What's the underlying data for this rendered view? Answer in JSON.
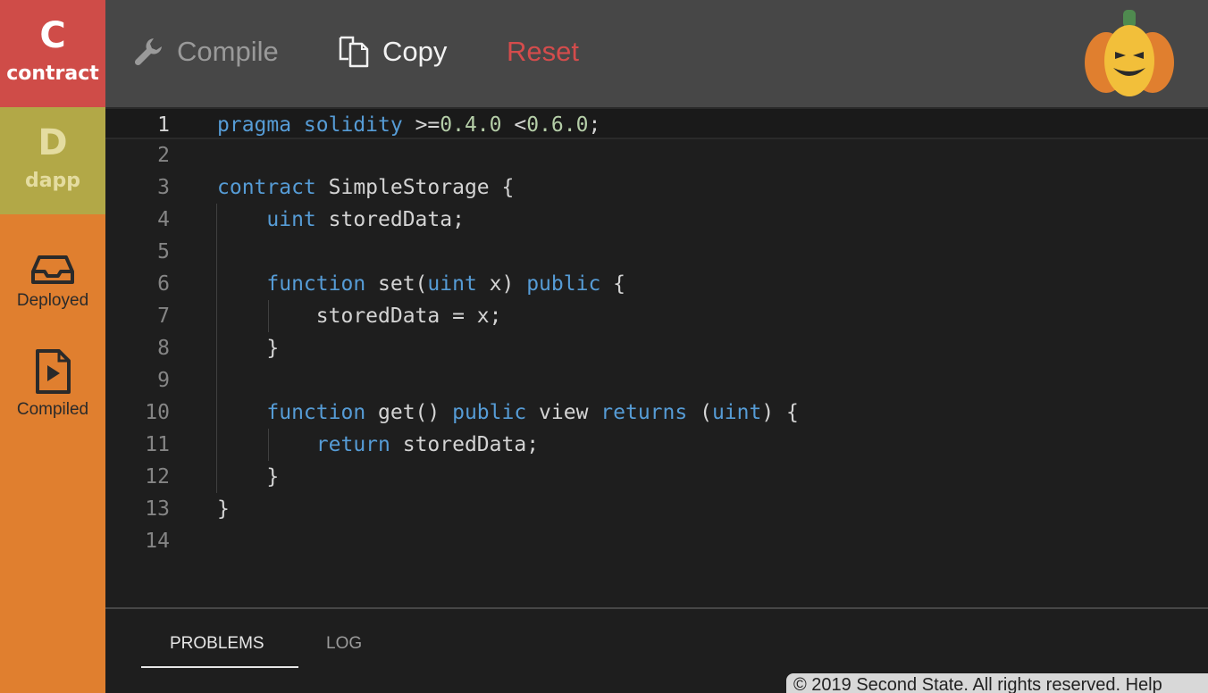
{
  "sidebar": {
    "contract": {
      "letter": "C",
      "label": "contract"
    },
    "dapp": {
      "letter": "D",
      "label": "dapp"
    },
    "deployed": {
      "label": "Deployed",
      "icon": "inbox-icon"
    },
    "compiled": {
      "label": "Compiled",
      "icon": "play-file-icon"
    }
  },
  "toolbar": {
    "compile_label": "Compile",
    "copy_label": "Copy",
    "reset_label": "Reset"
  },
  "editor": {
    "active_line": 1,
    "lines": [
      {
        "n": "1",
        "text": "pragma solidity >=0.4.0 <0.6.0;"
      },
      {
        "n": "2",
        "text": ""
      },
      {
        "n": "3",
        "text": "contract SimpleStorage {"
      },
      {
        "n": "4",
        "text": "    uint storedData;"
      },
      {
        "n": "5",
        "text": ""
      },
      {
        "n": "6",
        "text": "    function set(uint x) public {"
      },
      {
        "n": "7",
        "text": "        storedData = x;"
      },
      {
        "n": "8",
        "text": "    }"
      },
      {
        "n": "9",
        "text": ""
      },
      {
        "n": "10",
        "text": "    function get() public view returns (uint) {"
      },
      {
        "n": "11",
        "text": "        return storedData;"
      },
      {
        "n": "12",
        "text": "    }"
      },
      {
        "n": "13",
        "text": "}"
      },
      {
        "n": "14",
        "text": ""
      }
    ]
  },
  "panel": {
    "problems_label": "PROBLEMS",
    "log_label": "LOG"
  },
  "footer": {
    "text": "© 2019 Second State. All rights reserved. Help"
  },
  "colors": {
    "contract_tab": "#cf4c48",
    "dapp_tab": "#b2a847",
    "sidebar": "#e07f2f",
    "toolbar": "#474747",
    "reset": "#d44c4c",
    "keyword": "#569cd6",
    "number": "#b5cea8"
  }
}
